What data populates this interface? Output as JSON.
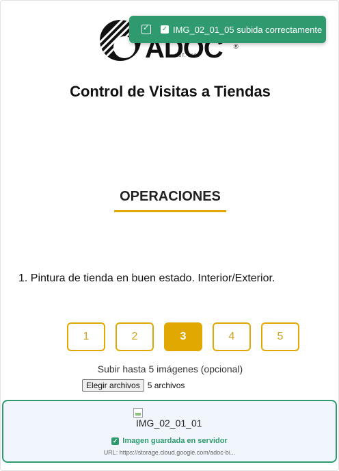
{
  "logo": {
    "word": "ADOC",
    "registered": "®",
    "est": "EST. 1953"
  },
  "title": "Control de Visitas a Tiendas",
  "section": "OPERACIONES",
  "question": "1. Pintura de tienda en buen estado. Interior/Exterior.",
  "steps": [
    {
      "label": "1",
      "active": false
    },
    {
      "label": "2",
      "active": false
    },
    {
      "label": "3",
      "active": true
    },
    {
      "label": "4",
      "active": false
    },
    {
      "label": "5",
      "active": false
    }
  ],
  "upload": {
    "hint": "Subir hasta 5 imágenes (opcional)",
    "button_label": "Elegir archivos",
    "files_selected": "5 archivos"
  },
  "image_card": {
    "alt_text": "IMG_02_01_01",
    "status": "Imagen guardada en servidor",
    "url": "URL: https://storage.cloud.google.com/adoc-bi..."
  },
  "toast": {
    "message": "IMG_02_01_05 subida correctamente"
  },
  "colors": {
    "accent": "#e0a800",
    "success": "#2e9a6e"
  }
}
